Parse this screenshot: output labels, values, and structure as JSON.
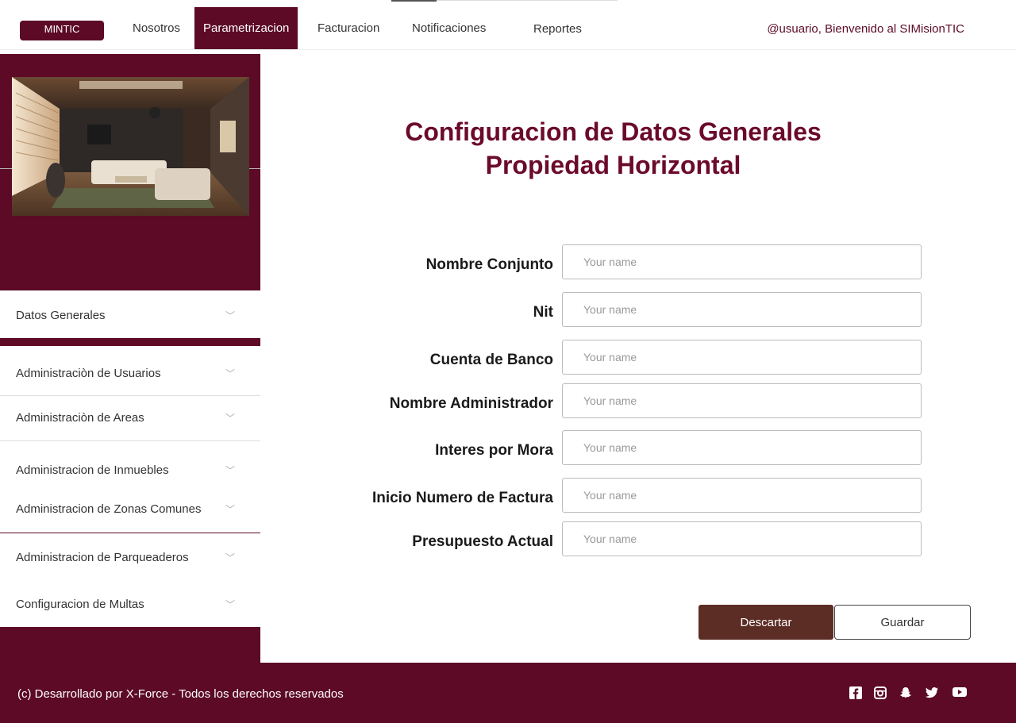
{
  "nav": {
    "brand": "MINTIC",
    "items": [
      {
        "label": "Nosotros"
      },
      {
        "label": "Parametrizacion",
        "active": true
      },
      {
        "label": "Facturacion"
      },
      {
        "label": "Notificaciones"
      },
      {
        "label": "Reportes"
      }
    ],
    "greeting": "@usuario, Bienvenido al SIMisionTIC"
  },
  "sidebar": {
    "items": [
      {
        "label": "Datos Generales",
        "icon": "chevron-down-icon"
      },
      {
        "label": "Administraciòn de Usuarios",
        "icon": "chevron-down-icon"
      },
      {
        "label": "Administraciòn de Areas",
        "icon": "chevron-down-icon"
      },
      {
        "label": "Administracion de Inmuebles",
        "icon": "chevron-down-icon"
      },
      {
        "label": "Administracion de Zonas Comunes",
        "icon": "chevron-down-icon"
      },
      {
        "label": "Administracion de Parqueaderos",
        "icon": "chevron-down-icon"
      },
      {
        "label": "Configuracion de Multas",
        "icon": "chevron-down-icon"
      }
    ]
  },
  "main": {
    "title_line1": "Configuracion de Datos Generales",
    "title_line2": "Propiedad Horizontal",
    "fields": [
      {
        "label": "Nombre Conjunto",
        "placeholder": "Your name",
        "value": ""
      },
      {
        "label": "Nit",
        "placeholder": "Your name",
        "value": ""
      },
      {
        "label": "Cuenta de Banco",
        "placeholder": "Your name",
        "value": ""
      },
      {
        "label": "Nombre Administrador",
        "placeholder": "Your name",
        "value": ""
      },
      {
        "label": "Interes por Mora",
        "placeholder": "Your name",
        "value": ""
      },
      {
        "label": "Inicio Numero de Factura",
        "placeholder": "Your name",
        "value": ""
      },
      {
        "label": "Presupuesto Actual",
        "placeholder": "Your name",
        "value": ""
      }
    ],
    "discard_label": "Descartar",
    "save_label": "Guardar"
  },
  "footer": {
    "text": "(c)  Desarrollado por X-Force - Todos los derechos reservados",
    "social": [
      "facebook-icon",
      "instagram-icon",
      "snapchat-icon",
      "twitter-icon",
      "youtube-icon"
    ]
  },
  "colors": {
    "brand": "#5c0a26",
    "title": "#6b0a2a",
    "discard": "#5c2d25"
  }
}
